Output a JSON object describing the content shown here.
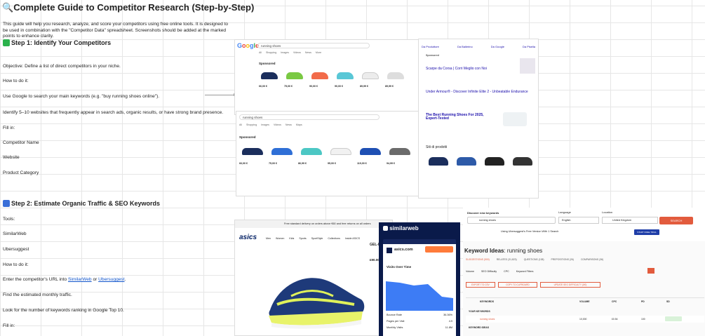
{
  "doc": {
    "title": "Complete Guide to Competitor Research (Step-by-Step)",
    "intro": "This guide will help you research, analyze, and score your competitors using free online tools. It is designed to be used in combination with the \"Competitor Data\" spreadsheet. Screenshots should be added at the marked points to enhance clarity.",
    "step1": "Step 1: Identify Your Competitors",
    "objective": "Objective: Define a list of direct competitors in your niche.",
    "how1": "How to do it:",
    "use_google": "Use Google to search your main keywords (e.g. \"buy running shoes online\").",
    "identify": "Identify 5–10 websites that frequently appear in search ads, organic results, or have strong brand presence.",
    "fill1": "Fill in:",
    "competitor_name": "Competitor Name",
    "website": "Website",
    "product_category": "Product Category",
    "step2": "Step 2: Estimate Organic Traffic & SEO Keywords",
    "tools": "Tools:",
    "similarweb": "SimilarWeb",
    "ubersuggest": "Ubersuggest",
    "how2": "How to do it:",
    "enter_prefix": "Enter the competitor's URL into ",
    "enter_link1": "SimilarWeb",
    "enter_or": " or ",
    "enter_link2": "Ubersuggest",
    "enter_suffix": ".",
    "find_traffic": "Find the estimated monthly traffic.",
    "look_keywords": "Look for the number of keywords ranking in Google Top 10.",
    "fill2": "Fill in:"
  },
  "google1": {
    "logo": "Google",
    "query": "running shoes",
    "tabs": [
      "All",
      "Shopping",
      "Images",
      "Videos",
      "News",
      "More"
    ],
    "sponsored": "Sponsored",
    "prices": [
      "66,00 €",
      "75,00 €",
      "90,00 €",
      "90,00 €",
      "89,99 €",
      "89,99 €"
    ]
  },
  "google2": {
    "query": "running shoes",
    "tabs": [
      "All",
      "Shopping",
      "Images",
      "Videos",
      "News",
      "Maps"
    ],
    "sponsored": "Sponsored",
    "prices": [
      "66,00 €",
      "75,00 €",
      "86,99 €",
      "95,00 €",
      "119,00 €",
      "94,99 €"
    ]
  },
  "google_right": {
    "sponsored": "Sponsored",
    "ad1_title": "Scarpe da Corsa | Corri Meglio con Noi",
    "ad2_title": "Under Armour® - Discover Infinite Elite 2 - Unbeatable Endurance",
    "org_title": "The Best Running Shoes For 2025, Expert-Tested",
    "siti": "Siti di prodotti",
    "filters": [
      "Da Produttore",
      "Da Ballerino",
      "Da Google",
      "Da Pisella"
    ]
  },
  "asics": {
    "banner": "Free standard delivery on orders above €60 and free returns on all orders",
    "logo": "asics",
    "nav": [
      "Men",
      "Women",
      "Kids",
      "Sports",
      "SportStyle",
      "Collections",
      "Inside ASICS"
    ],
    "product": "GEL-EX",
    "price": "£90.00"
  },
  "similarweb": {
    "logo": "similarweb",
    "domain": "asics.com",
    "visits_title": "Visits Over Time",
    "stats": [
      {
        "label": "Bounce Rate",
        "value": "36.36%"
      },
      {
        "label": "Pages per Visit",
        "value": "4.9"
      },
      {
        "label": "Monthly Visits",
        "value": "11.8M"
      }
    ]
  },
  "ubersuggest": {
    "discover": "Discover new keywords",
    "query": "running shoes",
    "language_label": "Language",
    "language": "English",
    "location_label": "Location",
    "location": "United Kingdom",
    "search_btn": "SEARCH",
    "free_version": "Using Ubersuggest's Free Version With 1 Search",
    "free_trial": "START FREE TRIAL",
    "ideas_title": "Keyword Ideas",
    "ideas_for": ": running shoes",
    "tabs": [
      "SUGGESTIONS (500)",
      "RELATED (31,823)",
      "QUESTIONS (138)",
      "PREPOSITIONS (26)",
      "COMPARISONS (36)"
    ],
    "filters": [
      "Volume",
      "SEO Difficulty",
      "CPC",
      "Keyword Filters"
    ],
    "export_csv": "EXPORT TO CSV",
    "copy_clip": "COPY TO CLIPBOARD",
    "update_sd": "UPDATE SEO DIFFICULTY (0/0)",
    "cols": [
      "KEYWORDS",
      "VOLUME",
      "CPC",
      "PD",
      "SD"
    ],
    "your_keywords": "YOUR KEYWORDS",
    "kw1": "running shoes",
    "kw1_volume": "10,000",
    "kw1_cpc": "£0.54",
    "kw1_pd": "100",
    "keyword_ideas": "KEYWORD IDEAS"
  },
  "colors": {
    "sheet_grid": "#e6e6e6",
    "link": "#1155cc",
    "ubersuggest_orange": "#e25b3d",
    "similarweb_navy": "#0a1a4a",
    "similarweb_chart": "#3d7cf5"
  }
}
